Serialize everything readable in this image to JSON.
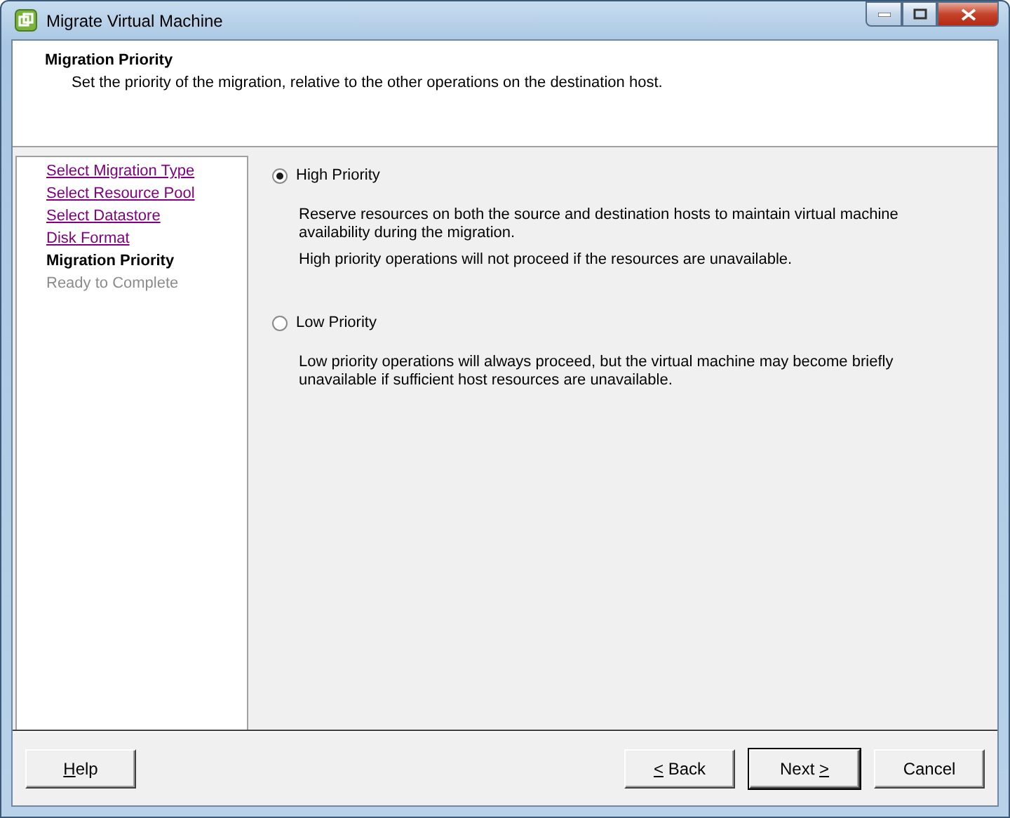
{
  "window": {
    "title": "Migrate Virtual Machine"
  },
  "header": {
    "title": "Migration Priority",
    "subtitle": "Set the priority of the migration, relative to the other operations on the destination host."
  },
  "steps": [
    {
      "label": "Select Migration Type",
      "visited": true,
      "current": false
    },
    {
      "label": "Select Resource Pool",
      "visited": true,
      "current": false
    },
    {
      "label": "Select Datastore",
      "visited": true,
      "current": false
    },
    {
      "label": "Disk Format",
      "visited": true,
      "current": false
    },
    {
      "label": "Migration Priority",
      "visited": false,
      "current": true
    },
    {
      "label": "Ready to Complete",
      "visited": false,
      "current": false
    }
  ],
  "options": [
    {
      "label": "High Priority",
      "selected": true,
      "description": [
        "Reserve resources on both the source and destination hosts to maintain virtual machine availability during the migration.",
        "High priority operations will not proceed if the resources are unavailable."
      ]
    },
    {
      "label": "Low Priority",
      "selected": false,
      "description": [
        "Low priority operations will always proceed, but the virtual machine may become briefly unavailable if sufficient host resources are unavailable."
      ]
    }
  ],
  "left_buttons": [
    {
      "parts": [
        {
          "text": "H",
          "underline": true
        },
        {
          "text": "elp",
          "underline": false
        }
      ],
      "default": false
    }
  ],
  "right_buttons": [
    {
      "parts": [
        {
          "text": "<",
          "underline": true
        },
        {
          "text": " Back",
          "underline": false
        }
      ],
      "default": false
    },
    {
      "parts": [
        {
          "text": "Next ",
          "underline": false
        },
        {
          "text": ">",
          "underline": true
        }
      ],
      "default": true
    },
    {
      "parts": [
        {
          "text": "Cancel",
          "underline": false
        }
      ],
      "default": false
    }
  ]
}
